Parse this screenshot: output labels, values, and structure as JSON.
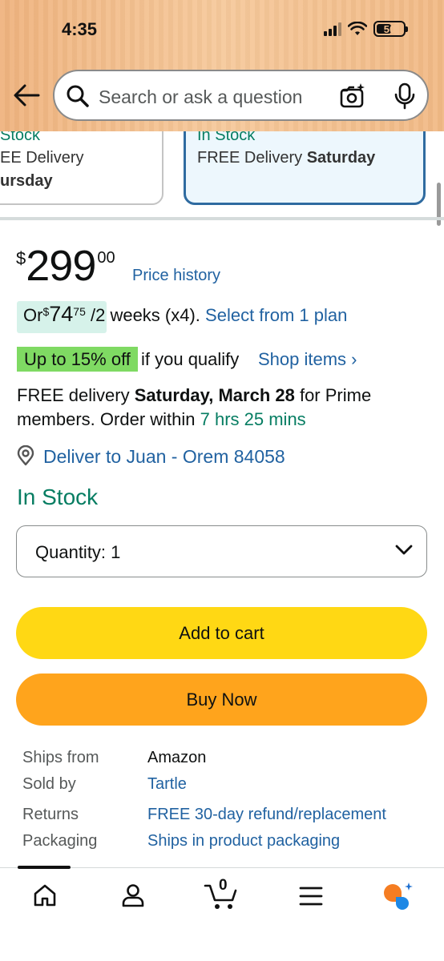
{
  "status_bar": {
    "time": "4:35",
    "battery": "50"
  },
  "search": {
    "placeholder": "Search or ask a question"
  },
  "delivery_options": {
    "left": {
      "stock": "Stock",
      "delivery": "EE Delivery",
      "day": "ursday"
    },
    "right": {
      "stock": "In Stock",
      "delivery_prefix": "FREE Delivery ",
      "day": "Saturday"
    }
  },
  "price": {
    "symbol": "$",
    "whole": "299",
    "fraction": "00",
    "history_link": "Price history"
  },
  "installment": {
    "prefix": "Or ",
    "symbol": "$",
    "whole": "74",
    "fraction": "75",
    "period": " /2 weeks (x4). ",
    "link": "Select from 1 plan"
  },
  "discount": {
    "badge": "Up to 15% off",
    "text": "if you qualify",
    "link": "Shop items ›"
  },
  "delivery": {
    "prefix": "FREE delivery ",
    "date": "Saturday, March 28",
    "middle": " for Prime members. Order within ",
    "countdown": "7 hrs 25 mins"
  },
  "deliver_to": "Deliver to Juan - Orem 84058",
  "availability": "In Stock",
  "quantity": {
    "label": "Quantity: 1"
  },
  "buttons": {
    "add_to_cart": "Add to cart",
    "buy_now": "Buy Now"
  },
  "details": [
    {
      "label": "Ships from",
      "value": "Amazon",
      "link": false
    },
    {
      "label": "Sold by",
      "value": "Tartle",
      "link": true
    },
    {
      "label": "Returns",
      "value": "FREE 30-day refund/replacement",
      "link": true
    },
    {
      "label": "Packaging",
      "value": "Ships in product packaging",
      "link": true
    }
  ],
  "bottom_nav": {
    "items": [
      "home-icon",
      "account-icon",
      "cart-icon",
      "menu-icon",
      "rufus-ai-icon"
    ],
    "cart_count": "0"
  },
  "colors": {
    "link": "#2162a1",
    "stock_green": "#067d62",
    "add_to_cart": "#ffd814",
    "buy_now": "#ffa41c",
    "discount_badge": "#7fda63",
    "selected_card_border": "#2f6ba0"
  }
}
